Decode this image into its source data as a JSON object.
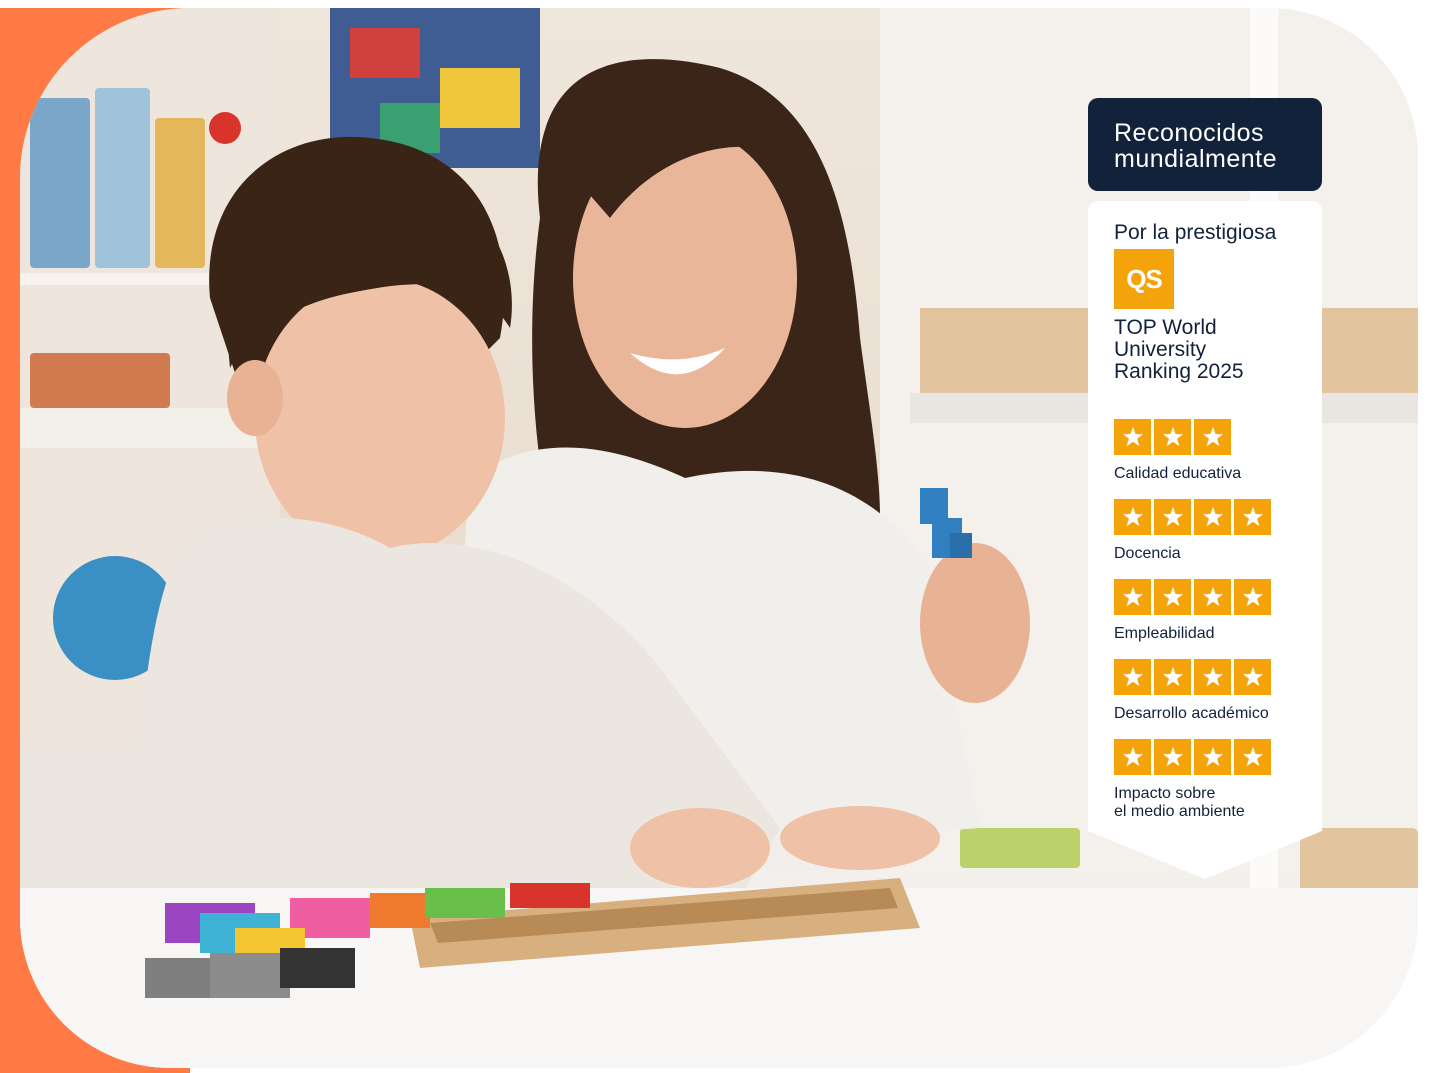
{
  "badge": {
    "heading_line1": "Reconocidos",
    "heading_line2": "mundialmente",
    "subtitle": "Por la prestigiosa",
    "logo_text": "QS",
    "ranking_line1": "TOP World",
    "ranking_line2": "University",
    "ranking_line3": "Ranking 2025",
    "ratings": [
      {
        "label_line1": "Calidad educativa",
        "label_line2": "",
        "stars": 3
      },
      {
        "label_line1": "Docencia",
        "label_line2": "",
        "stars": 4
      },
      {
        "label_line1": "Empleabilidad",
        "label_line2": "",
        "stars": 4
      },
      {
        "label_line1": "Desarrollo académico",
        "label_line2": "",
        "stars": 4
      },
      {
        "label_line1": "Impacto sobre",
        "label_line2": "el medio ambiente",
        "stars": 4
      }
    ]
  },
  "colors": {
    "accent_orange": "#ff7a45",
    "navy": "#12223a",
    "star_gold": "#f5a30b"
  },
  "icons": {
    "logo": "qs-logo",
    "rating_icon": "star-icon"
  }
}
